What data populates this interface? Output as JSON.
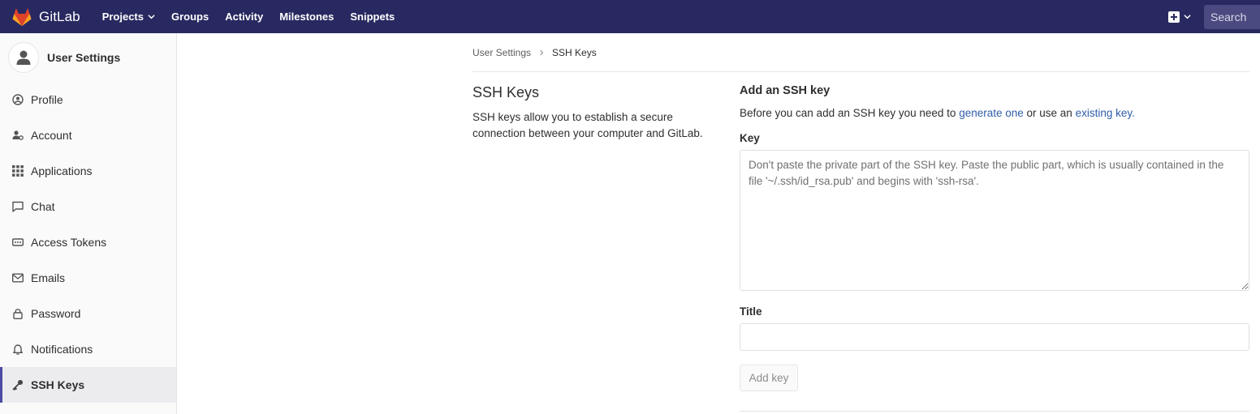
{
  "app": {
    "name": "GitLab"
  },
  "colors": {
    "nav_bg": "#292961",
    "link": "#2f5ea8",
    "active_bar": "#4b4ba3"
  },
  "topnav": {
    "items": [
      {
        "label": "Projects",
        "dropdown": true
      },
      {
        "label": "Groups"
      },
      {
        "label": "Activity"
      },
      {
        "label": "Milestones"
      },
      {
        "label": "Snippets"
      }
    ],
    "search_placeholder": "Search"
  },
  "sidebar": {
    "title": "User Settings",
    "items": [
      {
        "label": "Profile",
        "icon": "profile-icon"
      },
      {
        "label": "Account",
        "icon": "account-icon"
      },
      {
        "label": "Applications",
        "icon": "applications-icon"
      },
      {
        "label": "Chat",
        "icon": "chat-icon"
      },
      {
        "label": "Access Tokens",
        "icon": "token-icon"
      },
      {
        "label": "Emails",
        "icon": "envelope-icon"
      },
      {
        "label": "Password",
        "icon": "lock-icon"
      },
      {
        "label": "Notifications",
        "icon": "bell-icon"
      },
      {
        "label": "SSH Keys",
        "icon": "key-icon",
        "active": true
      }
    ]
  },
  "breadcrumb": {
    "parent": "User Settings",
    "current": "SSH Keys"
  },
  "section": {
    "title": "SSH Keys",
    "description": "SSH keys allow you to establish a secure connection between your computer and GitLab."
  },
  "form": {
    "heading": "Add an SSH key",
    "intro_before": "Before you can add an SSH key you need to ",
    "intro_link1": "generate one",
    "intro_mid": " or use an ",
    "intro_link2": "existing key.",
    "key_label": "Key",
    "key_placeholder": "Don't paste the private part of the SSH key. Paste the public part, which is usually contained in the file '~/.ssh/id_rsa.pub' and begins with 'ssh-rsa'.",
    "title_label": "Title",
    "title_value": "",
    "submit_label": "Add key"
  }
}
